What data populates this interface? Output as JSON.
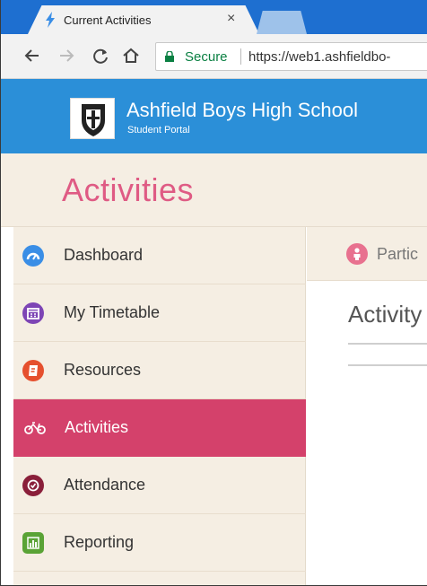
{
  "browser": {
    "tab_title": "Current Activities",
    "tab_close": "×",
    "secure_label": "Secure",
    "url": "https://web1.ashfieldbo-"
  },
  "header": {
    "school_name": "Ashfield Boys High School",
    "portal_label": "Student Portal"
  },
  "page": {
    "title": "Activities"
  },
  "sidebar": {
    "items": [
      {
        "label": "Dashboard",
        "icon": "dashboard-icon",
        "color": "#3a8ee6"
      },
      {
        "label": "My Timetable",
        "icon": "calendar-icon",
        "color": "#7d45b5"
      },
      {
        "label": "Resources",
        "icon": "book-icon",
        "color": "#e5502e"
      },
      {
        "label": "Activities",
        "icon": "bicycle-icon",
        "color": "#d4416b",
        "active": true
      },
      {
        "label": "Attendance",
        "icon": "check-circle-icon",
        "color": "#8a1f3a"
      },
      {
        "label": "Reporting",
        "icon": "bar-chart-icon",
        "color": "#5aa336"
      }
    ]
  },
  "main": {
    "tab_label": "Partic",
    "section_title": "Activity"
  },
  "colors": {
    "header_blue": "#2b8fd8",
    "accent_pink": "#d4416b",
    "panel_beige": "#f5eee3"
  }
}
